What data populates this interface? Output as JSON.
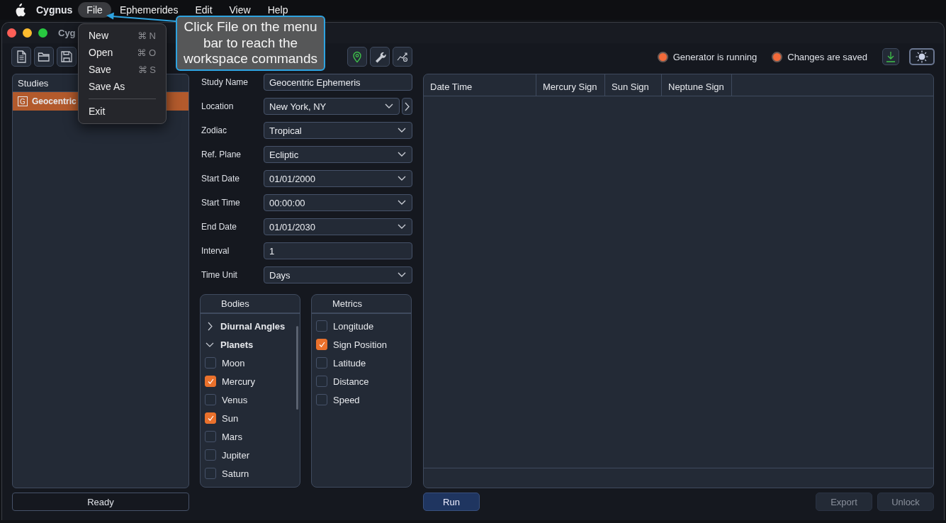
{
  "menubar": {
    "app": "Cygnus",
    "items": [
      {
        "label": "File",
        "selected": true
      },
      {
        "label": "Ephemerides",
        "selected": false
      },
      {
        "label": "Edit",
        "selected": false
      },
      {
        "label": "View",
        "selected": false
      },
      {
        "label": "Help",
        "selected": false
      }
    ]
  },
  "file_menu": {
    "items": [
      {
        "kind": "item",
        "label": "New",
        "shortcut": "⌘ N"
      },
      {
        "kind": "item",
        "label": "Open",
        "shortcut": "⌘ O"
      },
      {
        "kind": "item",
        "label": "Save",
        "shortcut": "⌘ S"
      },
      {
        "kind": "item",
        "label": "Save As"
      },
      {
        "kind": "separator"
      },
      {
        "kind": "item",
        "label": "Exit"
      }
    ]
  },
  "callout": {
    "text": "Click File on the menu bar to reach the workspace commands"
  },
  "window": {
    "title": "Cyg"
  },
  "toolbar": {
    "status": [
      {
        "label": "Generator is running",
        "color": "#f26a3a"
      },
      {
        "label": "Changes are saved",
        "color": "#f26a3a"
      }
    ]
  },
  "studies": {
    "title": "Studies",
    "items": [
      {
        "badge": "G",
        "label": "Geocentric",
        "selected": true
      }
    ]
  },
  "form": {
    "fields": [
      {
        "kind": "text",
        "label": "Study Name",
        "value": "Geocentric Ephemeris"
      },
      {
        "kind": "select-more",
        "label": "Location",
        "value": "New York, NY"
      },
      {
        "kind": "select",
        "label": "Zodiac",
        "value": "Tropical"
      },
      {
        "kind": "select",
        "label": "Ref. Plane",
        "value": "Ecliptic"
      },
      {
        "kind": "select",
        "label": "Start Date",
        "value": "01/01/2000"
      },
      {
        "kind": "select",
        "label": "Start Time",
        "value": "00:00:00"
      },
      {
        "kind": "select",
        "label": "End Date",
        "value": "01/01/2030"
      },
      {
        "kind": "text",
        "label": "Interval",
        "value": "1"
      },
      {
        "kind": "select",
        "label": "Time Unit",
        "value": "Days"
      }
    ]
  },
  "bodies": {
    "title": "Bodies",
    "items": [
      {
        "label": "Diurnal Angles",
        "expanded": false
      },
      {
        "label": "Planets",
        "expanded": true,
        "children": [
          {
            "label": "Moon",
            "checked": false
          },
          {
            "label": "Mercury",
            "checked": true
          },
          {
            "label": "Venus",
            "checked": false
          },
          {
            "label": "Sun",
            "checked": true
          },
          {
            "label": "Mars",
            "checked": false
          },
          {
            "label": "Jupiter",
            "checked": false
          },
          {
            "label": "Saturn",
            "checked": false
          }
        ]
      }
    ]
  },
  "metrics": {
    "title": "Metrics",
    "items": [
      {
        "label": "Longitude",
        "checked": false
      },
      {
        "label": "Sign Position",
        "checked": true
      },
      {
        "label": "Latitude",
        "checked": false
      },
      {
        "label": "Distance",
        "checked": false
      },
      {
        "label": "Speed",
        "checked": false
      }
    ]
  },
  "table": {
    "columns": [
      "Date Time",
      "Mercury Sign",
      "Sun Sign",
      "Neptune Sign"
    ]
  },
  "status_bar": {
    "text": "Ready"
  },
  "buttons": [
    {
      "label": "Run",
      "kind": "primary",
      "disabled": false
    },
    {
      "label": "Export",
      "kind": "plain",
      "disabled": true
    },
    {
      "label": "Unlock",
      "kind": "plain",
      "disabled": true
    }
  ]
}
